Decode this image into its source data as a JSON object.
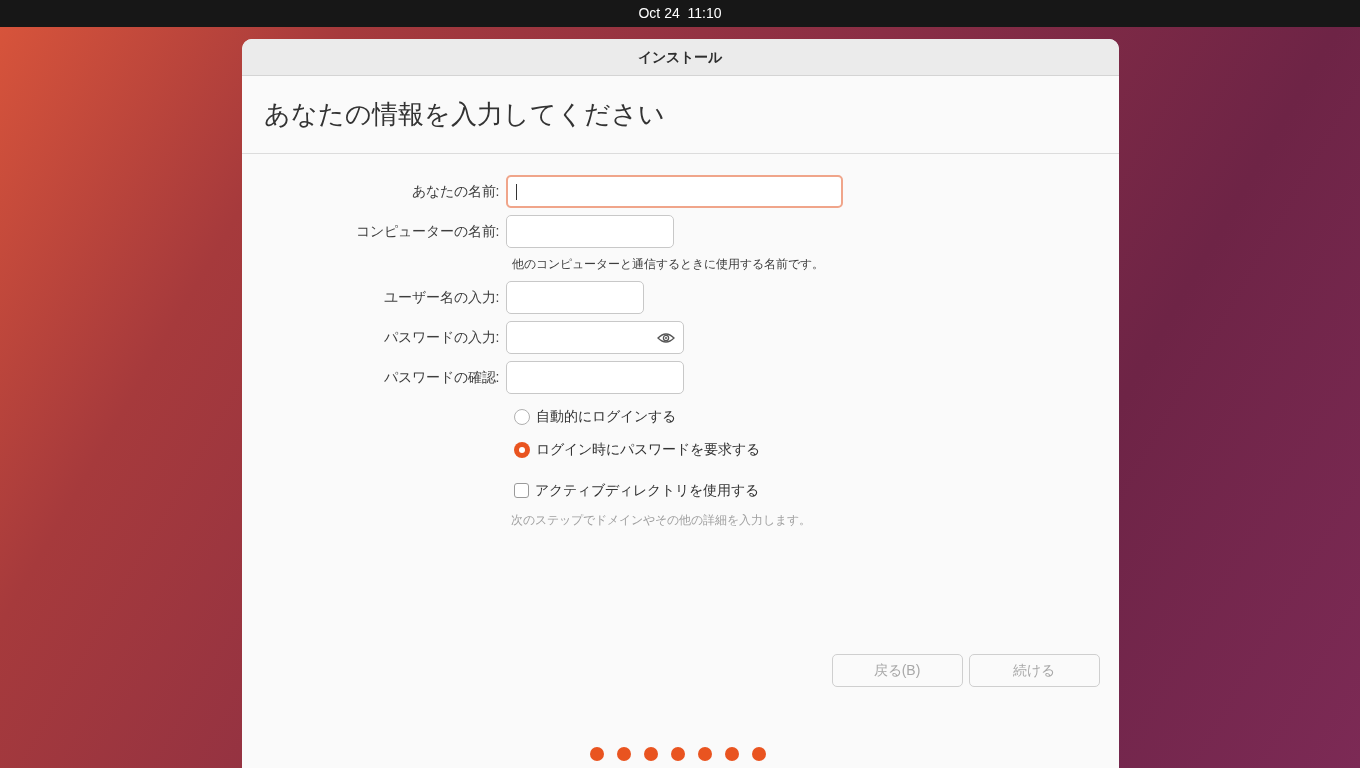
{
  "top_bar": {
    "clock": "Oct 24  11:10"
  },
  "window": {
    "title": "インストール"
  },
  "page_title": "あなたの情報を入力してください",
  "fields": [
    {
      "kind": "text",
      "label": "あなたの名前:",
      "focused": true
    },
    {
      "kind": "text",
      "label": "コンピューターの名前:",
      "focused": false,
      "hint": "他のコンピューターと通信するときに使用する名前です。"
    },
    {
      "kind": "text",
      "label": "ユーザー名の入力:",
      "focused": false
    },
    {
      "kind": "password",
      "label": "パスワードの入力:",
      "focused": false
    },
    {
      "kind": "text",
      "label": "パスワードの確認:",
      "focused": false
    }
  ],
  "login_options": [
    {
      "label": "自動的にログインする",
      "selected": false
    },
    {
      "label": "ログイン時にパスワードを要求する",
      "selected": true
    }
  ],
  "active_directory": {
    "label": "アクティブディレクトリを使用する",
    "checked": false,
    "hint": "次のステップでドメインやその他の詳細を入力します。"
  },
  "buttons": [
    {
      "label": "戻る(B)",
      "disabled": true
    },
    {
      "label": "続ける",
      "disabled": true
    }
  ],
  "progress_dots": [
    {
      "done": true
    },
    {
      "done": true
    },
    {
      "done": true
    },
    {
      "done": true
    },
    {
      "done": true
    },
    {
      "done": true
    },
    {
      "done": true
    }
  ]
}
